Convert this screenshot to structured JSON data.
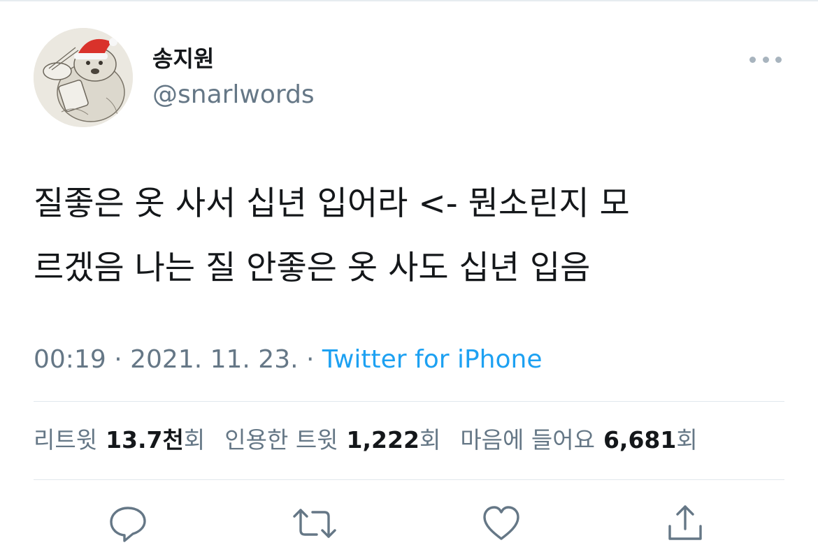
{
  "tweet": {
    "author": {
      "display_name": "송지원",
      "handle": "@snarlwords"
    },
    "text_lines": [
      "질좋은 옷 사서 십년 입어라 <- 뭔소린지 모",
      "르겠음 나는 질 안좋은 옷 사도 십년 입음"
    ],
    "time": "00:19",
    "date": "2021. 11. 23.",
    "separator": "·",
    "source": "Twitter for iPhone",
    "stats": {
      "retweets_label": "리트윗",
      "retweets_count": "13.7천",
      "retweets_unit": "회",
      "quotes_label": "인용한 트윗",
      "quotes_count": "1,222",
      "quotes_unit": "회",
      "likes_label": "마음에 들어요",
      "likes_count": "6,681",
      "likes_unit": "회"
    }
  },
  "icons": {
    "more": "more-horizontal-icon",
    "reply": "reply-icon",
    "retweet": "retweet-icon",
    "like": "heart-icon",
    "share": "share-icon"
  },
  "colors": {
    "text_primary": "#14171a",
    "text_secondary": "#657786",
    "link": "#1da1f2",
    "icon_gray": "#657786",
    "divider": "#e1e8ed"
  }
}
